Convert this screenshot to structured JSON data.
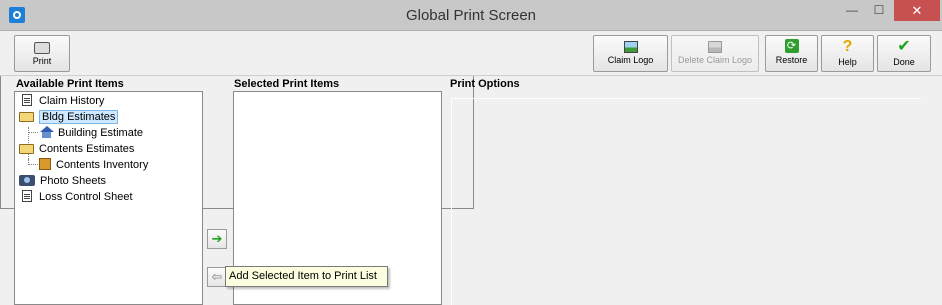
{
  "window": {
    "title": "Global Print Screen",
    "minimize_glyph": "—",
    "maximize_glyph": "☐",
    "close_glyph": "✕"
  },
  "toolbar": {
    "print_label": "Print",
    "claim_logo_label": "Claim Logo",
    "delete_claim_logo_label": "Delete Claim Logo",
    "restore_label": "Restore",
    "help_label": "Help",
    "done_label": "Done",
    "restore_glyph": "⟳",
    "help_glyph": "?",
    "done_glyph": "✔"
  },
  "sections": {
    "available_header": "Available Print Items",
    "selected_header": "Selected Print Items",
    "options_header": "Print Options"
  },
  "tree": [
    {
      "label": "Claim History",
      "icon": "document-icon",
      "level": 0
    },
    {
      "label": "Bldg Estimates",
      "icon": "folder-open-icon",
      "level": 0,
      "selected": true
    },
    {
      "label": "Building Estimate",
      "icon": "house-icon",
      "level": 1
    },
    {
      "label": "Contents Estimates",
      "icon": "folder-open-icon",
      "level": 0
    },
    {
      "label": "Contents Inventory",
      "icon": "box-icon",
      "level": 1
    },
    {
      "label": "Photo Sheets",
      "icon": "camera-icon",
      "level": 0
    },
    {
      "label": "Loss Control Sheet",
      "icon": "document-icon",
      "level": 0
    }
  ],
  "arrows": {
    "add_glyph": "➔",
    "remove_glyph": "⇦"
  },
  "tooltip": {
    "text": "Add Selected Item to Print List"
  },
  "colors": {
    "close_button": "#c75050",
    "selection_highlight": "#cde8ff",
    "tooltip_bg": "#fdfde0",
    "add_arrow": "#1fa31f"
  }
}
